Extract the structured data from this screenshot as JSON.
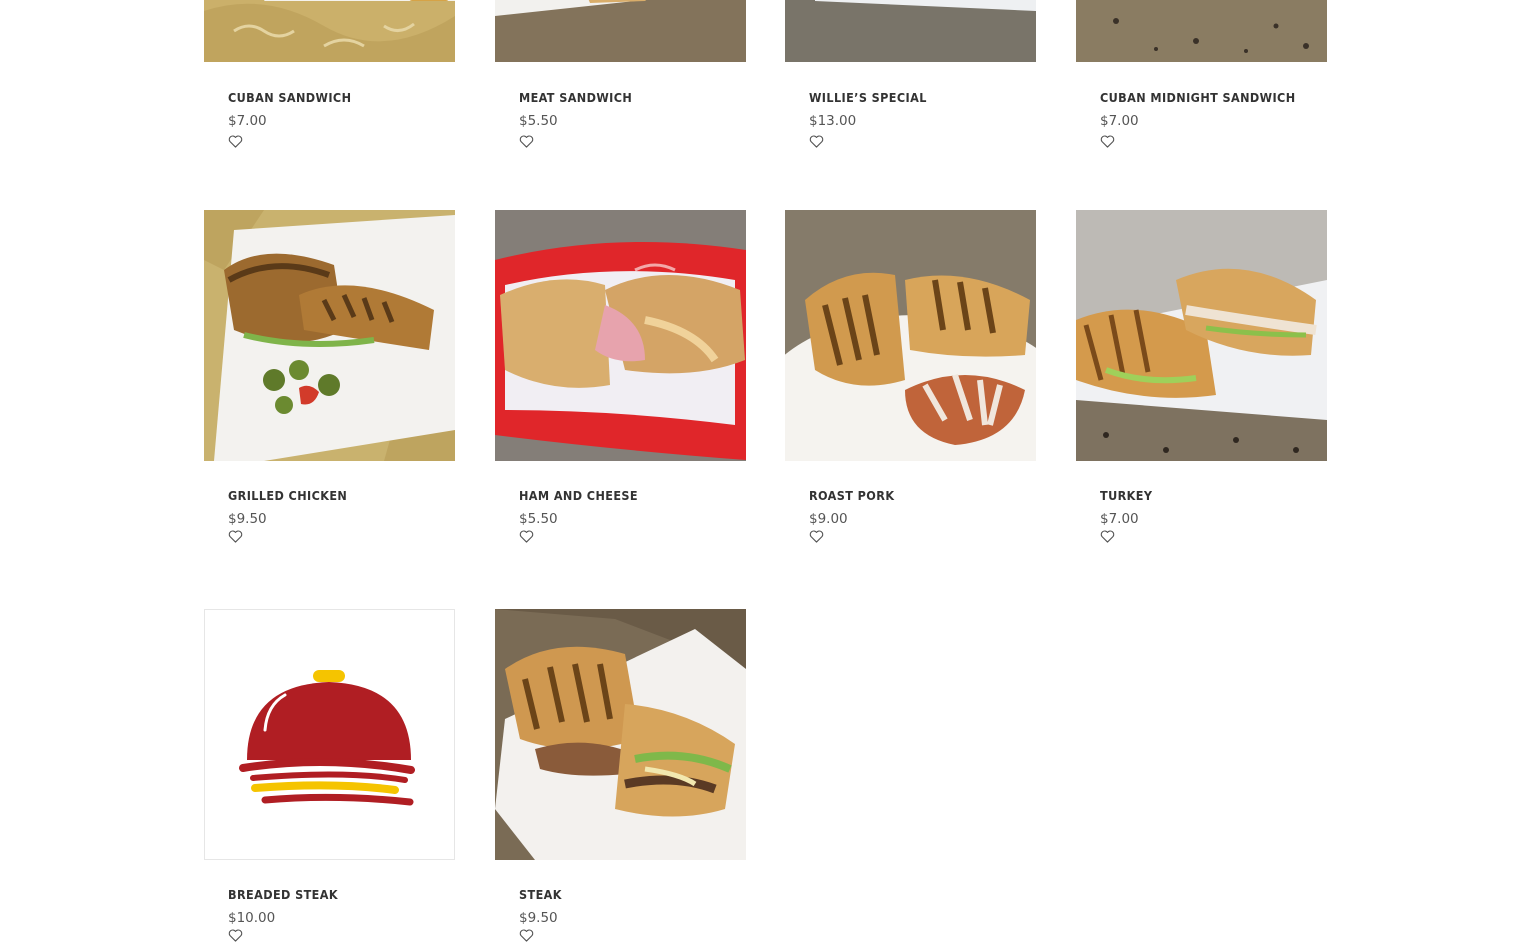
{
  "products": [
    {
      "name": "Cuban Sandwich",
      "price": "$7.00",
      "image": "sandwich-photo",
      "favorite_icon": "heart-outline-icon"
    },
    {
      "name": "Meat Sandwich",
      "price": "$5.50",
      "image": "sandwich-photo",
      "favorite_icon": "heart-outline-icon"
    },
    {
      "name": "Willie’s Special",
      "price": "$13.00",
      "image": "sandwich-photo",
      "favorite_icon": "heart-outline-icon"
    },
    {
      "name": "Cuban Midnight Sandwich",
      "price": "$7.00",
      "image": "sandwich-photo",
      "favorite_icon": "heart-outline-icon"
    },
    {
      "name": "Grilled Chicken",
      "price": "$9.50",
      "image": "sandwich-photo",
      "favorite_icon": "heart-outline-icon"
    },
    {
      "name": "Ham and Cheese",
      "price": "$5.50",
      "image": "sandwich-photo",
      "favorite_icon": "heart-outline-icon"
    },
    {
      "name": "Roast Pork",
      "price": "$9.00",
      "image": "sandwich-photo",
      "favorite_icon": "heart-outline-icon"
    },
    {
      "name": "Turkey",
      "price": "$7.00",
      "image": "sandwich-photo",
      "favorite_icon": "heart-outline-icon"
    },
    {
      "name": "Breaded Steak",
      "price": "$10.00",
      "image": "placeholder-cloche-logo",
      "favorite_icon": "heart-outline-icon"
    },
    {
      "name": "Steak",
      "price": "$9.50",
      "image": "sandwich-photo",
      "favorite_icon": "heart-outline-icon"
    }
  ],
  "colors": {
    "logo_red": "#b01e23",
    "logo_yellow": "#f5c400",
    "text": "#333333",
    "price": "#555555"
  }
}
